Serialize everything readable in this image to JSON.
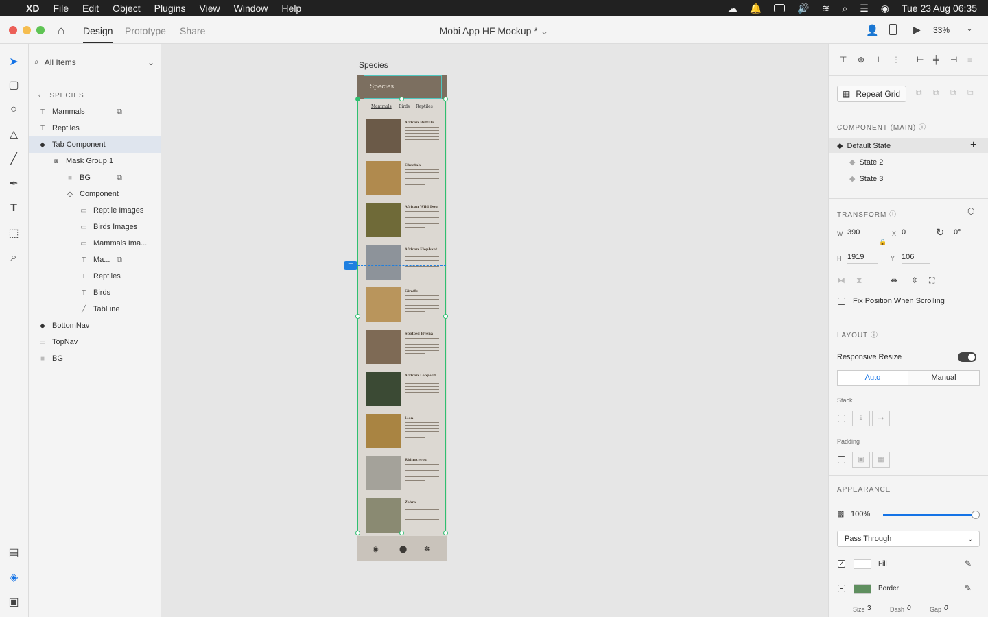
{
  "menubar": {
    "items": [
      "XD",
      "File",
      "Edit",
      "Object",
      "Plugins",
      "View",
      "Window",
      "Help"
    ],
    "clock": "Tue 23 Aug  06:35"
  },
  "titlebar": {
    "tabs": [
      "Design",
      "Prototype",
      "Share"
    ],
    "doc_title": "Mobi App HF Mockup *",
    "zoom": "33%"
  },
  "layers": {
    "search_placeholder": "All Items",
    "breadcrumb": "SPECIES",
    "items": [
      {
        "label": "Mammals",
        "icon": "text-icon"
      },
      {
        "label": "Reptiles",
        "icon": "text-icon"
      },
      {
        "label": "Tab Component",
        "icon": "component-icon"
      },
      {
        "label": "Mask Group 1",
        "icon": "mask-icon"
      },
      {
        "label": "BG",
        "icon": "rect-icon"
      },
      {
        "label": "Component",
        "icon": "component-icon"
      },
      {
        "label": "Reptile Images",
        "icon": "folder-icon"
      },
      {
        "label": "Birds Images",
        "icon": "folder-icon"
      },
      {
        "label": "Mammals Ima...",
        "icon": "folder-icon"
      },
      {
        "label": "Ma...",
        "icon": "text-icon"
      },
      {
        "label": "Reptiles",
        "icon": "text-icon"
      },
      {
        "label": "Birds",
        "icon": "text-icon"
      },
      {
        "label": "TabLine",
        "icon": "line-icon"
      },
      {
        "label": "BottomNav",
        "icon": "component-icon"
      },
      {
        "label": "TopNav",
        "icon": "folder-icon"
      },
      {
        "label": "BG",
        "icon": "rect-icon"
      }
    ]
  },
  "canvas": {
    "artboard_label": "Species",
    "header_title": "Species",
    "tabs": [
      "Mammals",
      "Birds",
      "Reptiles"
    ],
    "animals": [
      {
        "name": "African Buffalo",
        "color": "#6b5a48"
      },
      {
        "name": "Cheetah",
        "color": "#b08a4e"
      },
      {
        "name": "African Wild Dog",
        "color": "#6f6a38"
      },
      {
        "name": "African Elephant",
        "color": "#8d939a"
      },
      {
        "name": "Giraffe",
        "color": "#b9955c"
      },
      {
        "name": "Spotted Hyena",
        "color": "#7e6a55"
      },
      {
        "name": "African Leopard",
        "color": "#3b4a34"
      },
      {
        "name": "Lion",
        "color": "#a98442"
      },
      {
        "name": "Rhinoceros",
        "color": "#a4a29a"
      },
      {
        "name": "Zebra",
        "color": "#8a8a72"
      }
    ]
  },
  "props": {
    "repeat_grid": "Repeat Grid",
    "component_header": "COMPONENT (MAIN)",
    "states": [
      "Default State",
      "State 2",
      "State 3"
    ],
    "transform_header": "TRANSFORM",
    "w_label": "W",
    "w_value": "390",
    "x_label": "X",
    "x_value": "0",
    "rotation": "0°",
    "h_label": "H",
    "h_value": "1919",
    "y_label": "Y",
    "y_value": "106",
    "fix_position": "Fix Position When Scrolling",
    "layout_header": "LAYOUT",
    "responsive_resize": "Responsive Resize",
    "auto": "Auto",
    "manual": "Manual",
    "stack": "Stack",
    "padding": "Padding",
    "appearance_header": "APPEARANCE",
    "opacity": "100%",
    "blend": "Pass Through",
    "fill": "Fill",
    "border": "Border",
    "border_color": "#5f8f5f",
    "size_label": "Size",
    "size_value": "3",
    "dash_label": "Dash",
    "dash_value": "0",
    "gap_label": "Gap",
    "gap_value": "0"
  }
}
